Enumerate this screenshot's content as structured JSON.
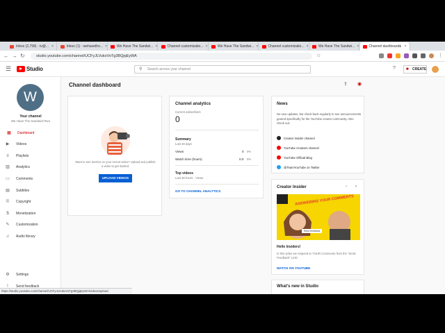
{
  "tabs": [
    {
      "label": "Inbox (2,799) - tv@...",
      "color": "#ea4335"
    },
    {
      "label": "Inbox (1) - wehavetho...",
      "color": "#ea4335"
    },
    {
      "label": "We Have The Sandwi...",
      "color": "#ff0000"
    },
    {
      "label": "Channel customizatio...",
      "color": "#ff0000"
    },
    {
      "label": "We Have The Sandwi...",
      "color": "#ff0000"
    },
    {
      "label": "Channel customizatio...",
      "color": "#ff0000"
    },
    {
      "label": "We Have The Sandwi...",
      "color": "#ff0000"
    },
    {
      "label": "Channel dashboard",
      "color": "#ff0000"
    }
  ],
  "browser": {
    "url": "studio.youtube.com/channel/UCFyJLVukxVoTg3BQjqEyWA",
    "new_tab": "+"
  },
  "header": {
    "brand": "Studio",
    "search_placeholder": "Search across your channel",
    "create_label": "CREATE"
  },
  "sidebar": {
    "avatar_letter": "W",
    "channel_label": "Your channel",
    "channel_name": "We Have The SandwichTwo",
    "items": [
      {
        "label": "Dashboard",
        "icon": "dashboard-icon",
        "glyph": "▦",
        "active": true
      },
      {
        "label": "Videos",
        "icon": "videos-icon",
        "glyph": "▶",
        "active": false
      },
      {
        "label": "Playlists",
        "icon": "playlists-icon",
        "glyph": "≡",
        "active": false
      },
      {
        "label": "Analytics",
        "icon": "analytics-icon",
        "glyph": "▥",
        "active": false
      },
      {
        "label": "Comments",
        "icon": "comments-icon",
        "glyph": "▭",
        "active": false
      },
      {
        "label": "Subtitles",
        "icon": "subtitles-icon",
        "glyph": "▤",
        "active": false
      },
      {
        "label": "Copyright",
        "icon": "copyright-icon",
        "glyph": "©",
        "active": false
      },
      {
        "label": "Monetization",
        "icon": "monetization-icon",
        "glyph": "$",
        "active": false
      },
      {
        "label": "Customization",
        "icon": "customization-icon",
        "glyph": "✎",
        "active": false
      },
      {
        "label": "Audio library",
        "icon": "audio-library-icon",
        "glyph": "♫",
        "active": false
      }
    ],
    "settings_label": "Settings",
    "feedback_label": "Send feedback"
  },
  "main": {
    "title": "Channel dashboard",
    "upload_card": {
      "text": "Want to see metrics on your recent video? Upload and publish a video to get started.",
      "button": "UPLOAD VIDEOS"
    },
    "analytics": {
      "title": "Channel analytics",
      "current_subs_label": "Current subscribers",
      "current_subs": "0",
      "summary_label": "Summary",
      "summary_period": "Last 28 days",
      "views_label": "Views",
      "views_value": "0",
      "views_change": "0%",
      "watch_label": "Watch time (hours)",
      "watch_value": "0.0",
      "watch_change": "0%",
      "top_label": "Top videos",
      "top_period": "Last 48 hours · Views",
      "link": "GO TO CHANNEL ANALYTICS"
    },
    "news": {
      "title": "News",
      "body": "No new updates, but check back regularly to see announcements geared specifically for the YouTube creator community. Also check out:",
      "links": [
        {
          "label": "Creator Insider channel",
          "color": "#222"
        },
        {
          "label": "YouTube Creators channel",
          "color": "#f00"
        },
        {
          "label": "YouTube Official Blog",
          "color": "#f00"
        },
        {
          "label": "@TeamYouTube on Twitter",
          "color": "#1da1f2"
        }
      ]
    },
    "insider": {
      "title": "Creator Insider",
      "thumb_overlay": "Send feedback",
      "thumb_text": "ANSWERING YOUR COMMENTS",
      "video_title": "Hello Insiders!",
      "body": "In this video we respond to YOUR Comments from the \"Send Feedback\" Link!",
      "link": "WATCH ON YOUTUBE"
    },
    "whatsnew_title": "What's new in Studio"
  },
  "statusbar": "https://studio.youtube.com/channel/UCFyJLVukxVoTg3BQjqEyWA/videos/upload"
}
